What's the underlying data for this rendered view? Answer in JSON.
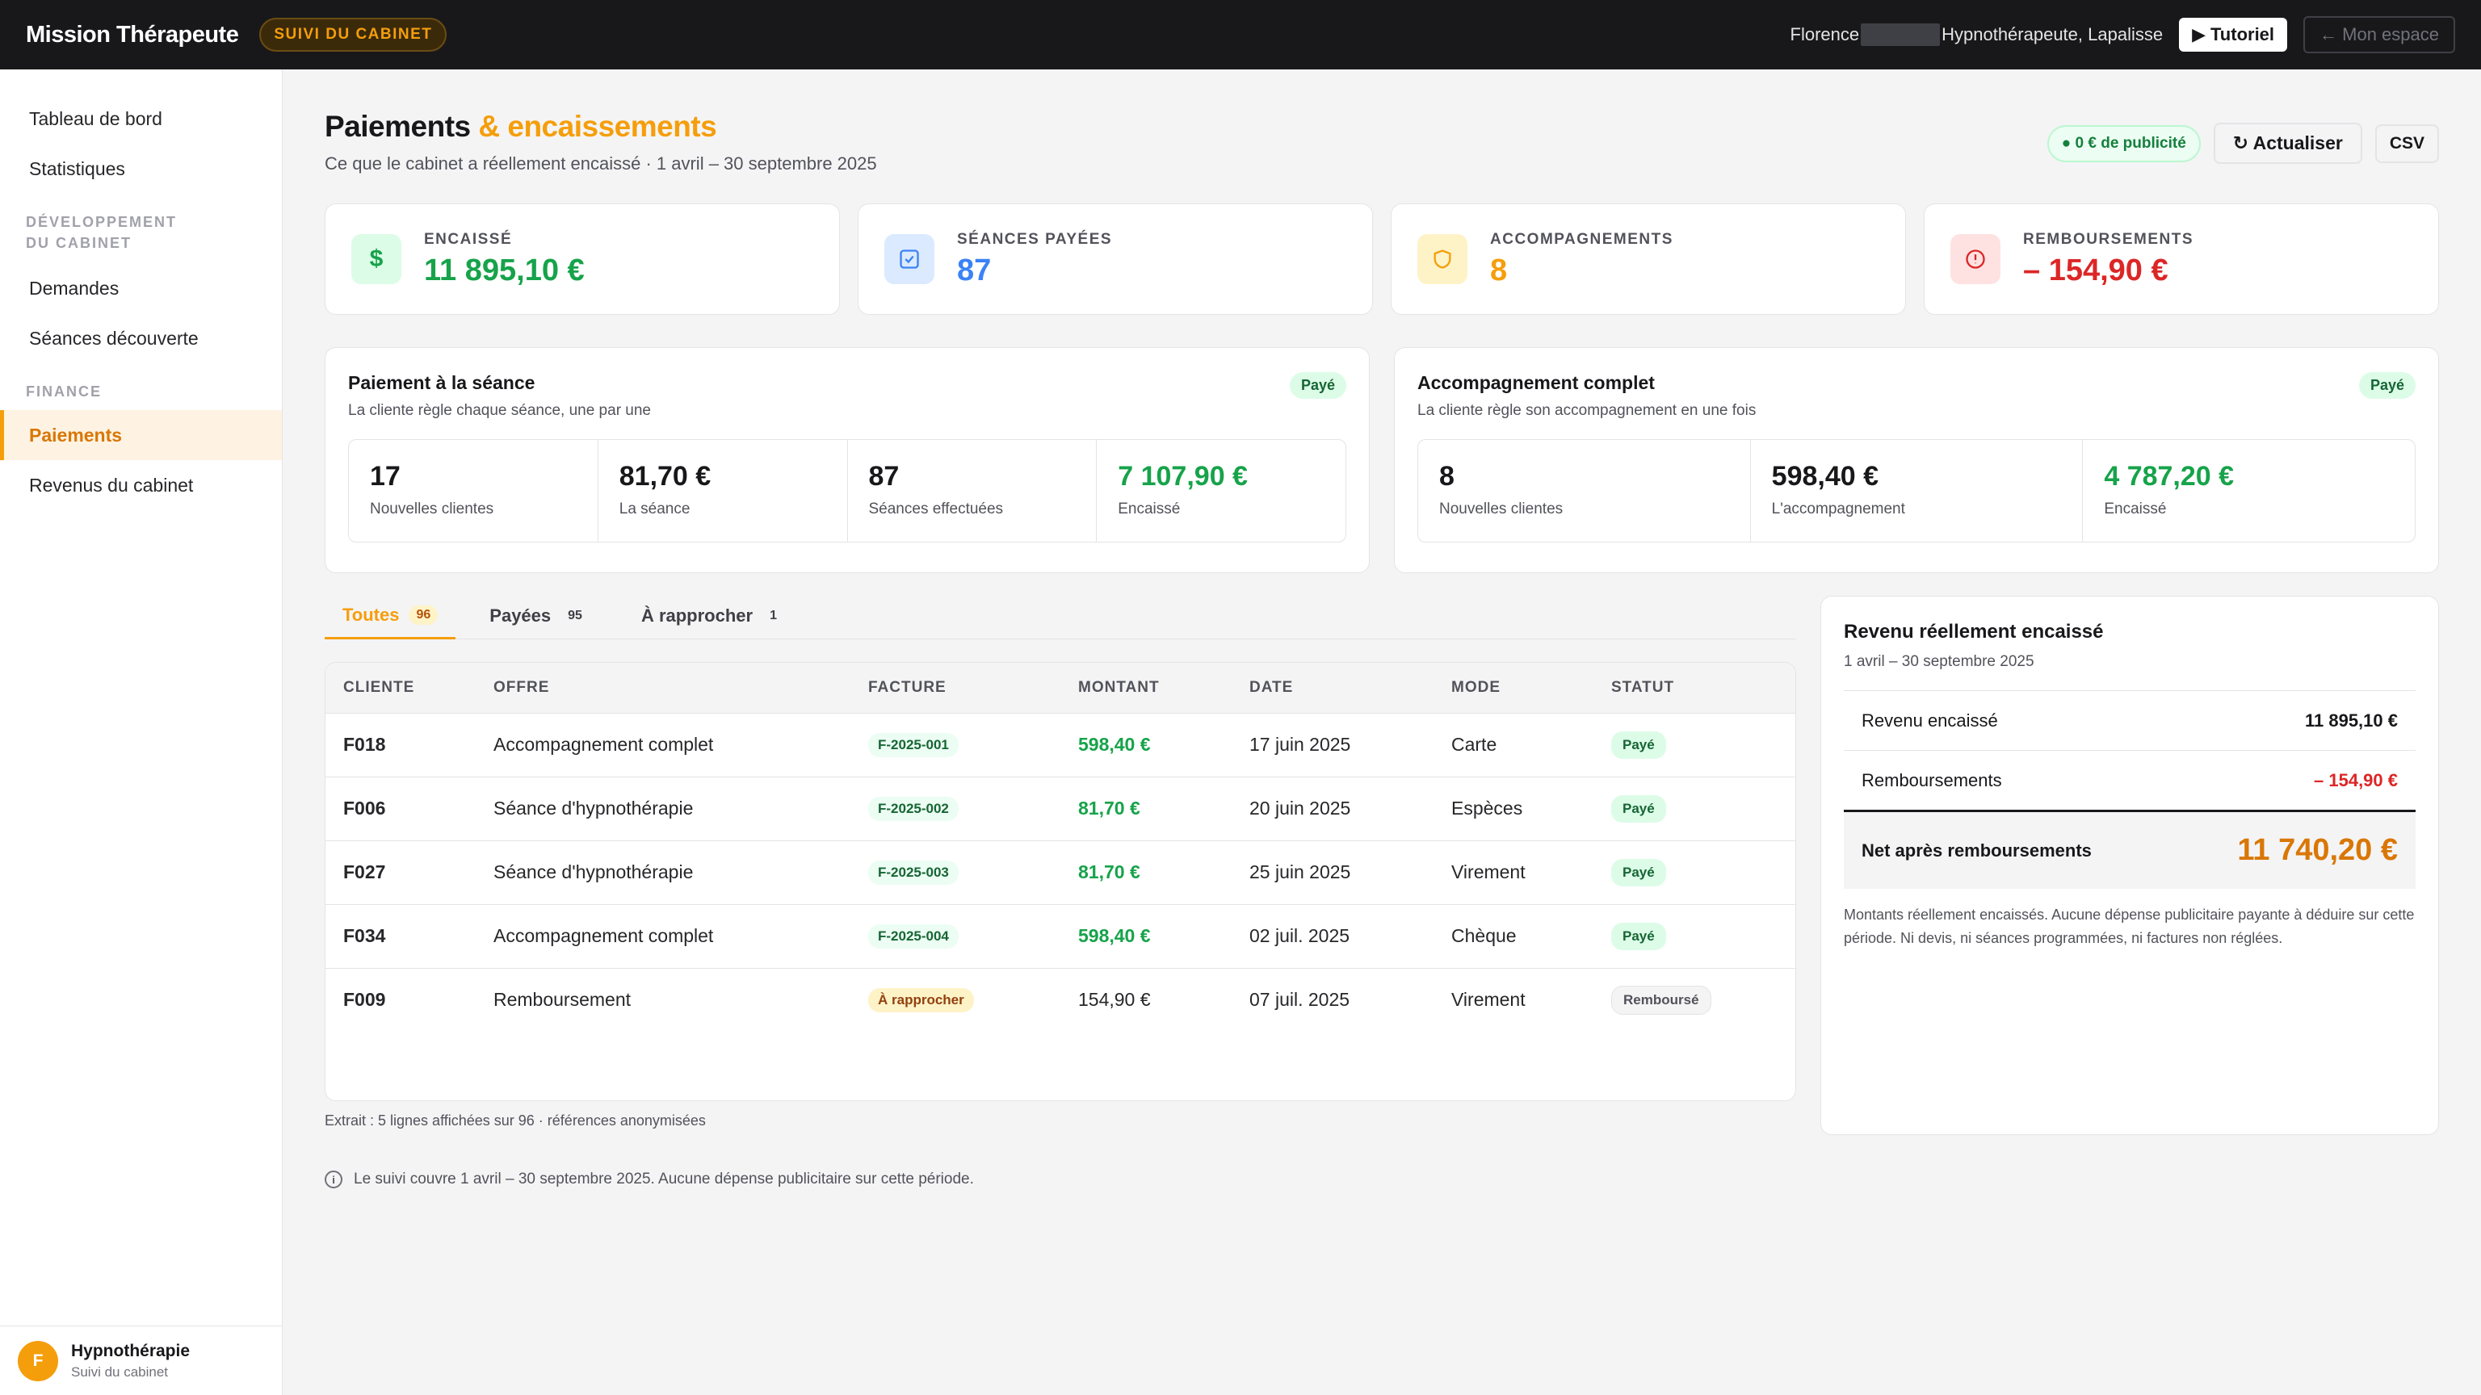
{
  "topbar": {
    "brand": "Mission Thérapeute",
    "badge": "SUIVI DU CABINET",
    "user_first": "Florence",
    "user_rest": "Hypnothérapeute, Lapalisse",
    "tutorial": "Tutoriel",
    "my_space": "← Mon espace"
  },
  "sidebar": {
    "items_top": [
      {
        "label": "Tableau de bord"
      },
      {
        "label": "Statistiques"
      }
    ],
    "section_dev": "DÉVELOPPEMENT DU CABINET",
    "items_dev": [
      {
        "label": "Demandes"
      },
      {
        "label": "Séances découverte"
      }
    ],
    "section_fin": "FINANCE",
    "items_fin": [
      {
        "label": "Paiements"
      },
      {
        "label": "Revenus du cabinet"
      }
    ],
    "footer": {
      "avatar": "F",
      "title": "Hypnothérapie",
      "subtitle": "Suivi du cabinet"
    }
  },
  "header": {
    "title_main": "Paiements",
    "title_accent": " & encaissements",
    "subtitle": "Ce que le cabinet a réellement encaissé · 1 avril – 30 septembre 2025",
    "ad_pill": "● 0 € de publicité",
    "refresh": "↻ Actualiser",
    "csv": "CSV"
  },
  "kpis": [
    {
      "label": "ENCAISSÉ",
      "value": "11 895,10 €",
      "icon": "dollar-icon",
      "color": "#16a34a"
    },
    {
      "label": "SÉANCES PAYÉES",
      "value": "87",
      "icon": "check-square-icon",
      "color": "#3b82f6"
    },
    {
      "label": "ACCOMPAGNEMENTS",
      "value": "8",
      "icon": "shield-icon",
      "color": "#f59e0b"
    },
    {
      "label": "REMBOURSEMENTS",
      "value": "– 154,90 €",
      "icon": "alert-circle-icon",
      "color": "#dc2626"
    }
  ],
  "offers": [
    {
      "title": "Paiement à la séance",
      "subtitle": "La cliente règle chaque séance, une par une",
      "pill": "Payé",
      "stats": [
        {
          "value": "17",
          "label": "Nouvelles clientes"
        },
        {
          "value": "81,70 €",
          "label": "La séance"
        },
        {
          "value": "87",
          "label": "Séances effectuées"
        },
        {
          "value": "7 107,90 €",
          "label": "Encaissé"
        }
      ]
    },
    {
      "title": "Accompagnement complet",
      "subtitle": "La cliente règle son accompagnement en une fois",
      "pill": "Payé",
      "stats": [
        {
          "value": "8",
          "label": "Nouvelles clientes"
        },
        {
          "value": "598,40 €",
          "label": "L'accompagnement"
        },
        {
          "value": "4 787,20 €",
          "label": "Encaissé"
        }
      ]
    }
  ],
  "tabs": [
    {
      "label": "Toutes",
      "count": "96"
    },
    {
      "label": "Payées",
      "count": "95"
    },
    {
      "label": "À rapprocher",
      "count": "1"
    }
  ],
  "table": {
    "headers": [
      "CLIENTE",
      "OFFRE",
      "FACTURE",
      "MONTANT",
      "DATE",
      "MODE",
      "STATUT"
    ],
    "rows": [
      {
        "client": "F018",
        "offer": "Accompagnement complet",
        "invoice": "F-2025-001",
        "amount": "598,40 €",
        "date": "17 juin 2025",
        "mode": "Carte",
        "status": "Payé"
      },
      {
        "client": "F006",
        "offer": "Séance d'hypnothérapie",
        "invoice": "F-2025-002",
        "amount": "81,70 €",
        "date": "20 juin 2025",
        "mode": "Espèces",
        "status": "Payé"
      },
      {
        "client": "F027",
        "offer": "Séance d'hypnothérapie",
        "invoice": "F-2025-003",
        "amount": "81,70 €",
        "date": "25 juin 2025",
        "mode": "Virement",
        "status": "Payé"
      },
      {
        "client": "F034",
        "offer": "Accompagnement complet",
        "invoice": "F-2025-004",
        "amount": "598,40 €",
        "date": "02 juil. 2025",
        "mode": "Chèque",
        "status": "Payé"
      },
      {
        "client": "F009",
        "offer": "Remboursement",
        "invoice": "À rapprocher",
        "amount": "154,90 €",
        "date": "07 juil. 2025",
        "mode": "Virement",
        "status": "Remboursé"
      }
    ],
    "note": "Extrait : 5 lignes affichées sur 96 · références anonymisées"
  },
  "info": "Le suivi couvre 1 avril – 30 septembre 2025. Aucune dépense publicitaire sur cette période.",
  "revenue": {
    "title": "Revenu réellement encaissé",
    "subtitle": "1 avril – 30 septembre 2025",
    "rows": [
      {
        "label": "Revenu encaissé",
        "value": "11 895,10 €"
      },
      {
        "label": "Remboursements",
        "value": "– 154,90 €"
      }
    ],
    "net_label": "Net après remboursements",
    "net_value": "11 740,20 €",
    "note": "Montants réellement encaissés. Aucune dépense publicitaire payante à déduire sur cette période. Ni devis, ni séances programmées, ni factures non réglées."
  }
}
